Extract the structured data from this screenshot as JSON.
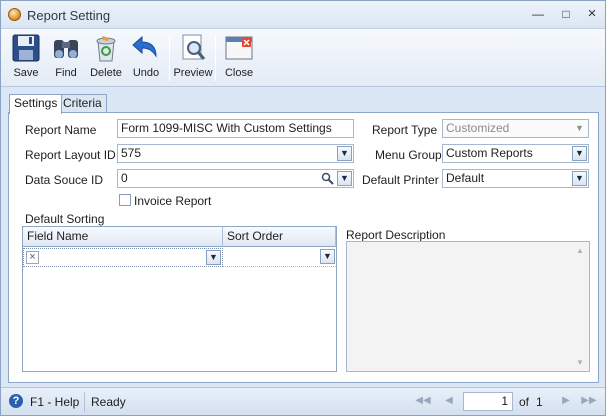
{
  "window": {
    "title": "Report Setting"
  },
  "toolbar": {
    "items": [
      {
        "label": "Save",
        "icon": "floppy-disk-icon"
      },
      {
        "label": "Find",
        "icon": "binoculars-icon"
      },
      {
        "label": "Delete",
        "icon": "recycle-bin-icon"
      },
      {
        "label": "Undo",
        "icon": "undo-arrow-icon"
      },
      {
        "label": "Preview",
        "icon": "magnifier-page-icon"
      },
      {
        "label": "Close",
        "icon": "close-window-icon"
      }
    ]
  },
  "tabs": [
    {
      "label": "Settings",
      "active": true
    },
    {
      "label": "Criteria",
      "active": false
    }
  ],
  "form": {
    "report_name_label": "Report Name",
    "report_name_value": "Form 1099-MISC With Custom Settings",
    "report_layout_id_label": "Report Layout ID",
    "report_layout_id_value": "575",
    "data_source_id_label": "Data Souce ID",
    "data_source_id_value": "0",
    "invoice_report_label": "Invoice Report",
    "invoice_report_checked": false,
    "report_type_label": "Report Type",
    "report_type_value": "Customized",
    "menu_group_label": "Menu Group",
    "menu_group_value": "Custom Reports",
    "default_printer_label": "Default Printer",
    "default_printer_value": "Default"
  },
  "sorting": {
    "title": "Default Sorting",
    "columns": [
      "Field Name",
      "Sort Order"
    ]
  },
  "description": {
    "title": "Report Description"
  },
  "status": {
    "help": "F1 - Help",
    "state": "Ready",
    "page": "1",
    "of_label": "of",
    "total": "1"
  },
  "colors": {
    "accent": "#dce7f5",
    "border": "#8ea6c6"
  }
}
